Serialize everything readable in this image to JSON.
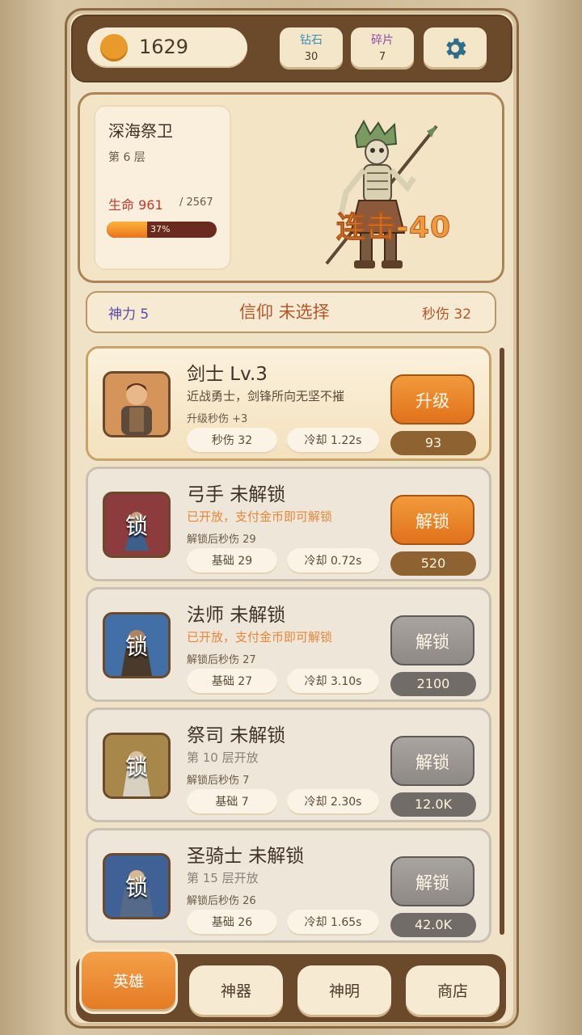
{
  "topbar": {
    "gold": "1629",
    "diamond": {
      "label": "钻石",
      "count": "30"
    },
    "shards": {
      "label": "碎片",
      "count": "7"
    }
  },
  "boss": {
    "name": "深海祭卫",
    "floor": "第 6 层",
    "hp_label": "生命 961",
    "hp_max": "/ 2567",
    "hp_percent_text": "37%",
    "hp_fraction": 0.37,
    "combo_text": "连击-40"
  },
  "stats": {
    "power": "神力 5",
    "faith": "信仰 未选择",
    "dps": "秒伤 32"
  },
  "heroes": [
    {
      "title": "剑士 Lv.3",
      "desc": "近战勇士，剑锋所向无坚不摧",
      "bonus": "升级秒伤 +3",
      "base": "秒伤 32",
      "cooldown": "冷却 1.22s",
      "action": "升级",
      "cost": "93",
      "lock": ""
    },
    {
      "title": "弓手 未解锁",
      "desc": "已开放，支付金币即可解锁",
      "bonus": "解锁后秒伤 29",
      "base": "基础 29",
      "cooldown": "冷却 0.72s",
      "action": "解锁",
      "cost": "520",
      "lock": "锁"
    },
    {
      "title": "法师 未解锁",
      "desc": "已开放，支付金币即可解锁",
      "bonus": "解锁后秒伤 27",
      "base": "基础 27",
      "cooldown": "冷却 3.10s",
      "action": "解锁",
      "cost": "2100",
      "lock": "锁"
    },
    {
      "title": "祭司 未解锁",
      "desc": "第 10 层开放",
      "bonus": "解锁后秒伤 7",
      "base": "基础 7",
      "cooldown": "冷却 2.30s",
      "action": "解锁",
      "cost": "12.0K",
      "lock": "锁"
    },
    {
      "title": "圣骑士 未解锁",
      "desc": "第 15 层开放",
      "bonus": "解锁后秒伤 26",
      "base": "基础 26",
      "cooldown": "冷却 1.65s",
      "action": "解锁",
      "cost": "42.0K",
      "lock": "锁"
    }
  ],
  "nav": {
    "heroes": "英雄",
    "artifacts": "神器",
    "gods": "神明",
    "shop": "商店"
  },
  "colors": {
    "accent_orange": "#e47a22",
    "frame_brown": "#6b4a2b",
    "hp_red": "#c0392b",
    "locked_gray": "#8e8984",
    "open_orange_text": "#e8873a"
  },
  "icons": [
    "coin-icon",
    "gear-icon",
    "lock-icon",
    "boss-skeleton-sprite"
  ]
}
